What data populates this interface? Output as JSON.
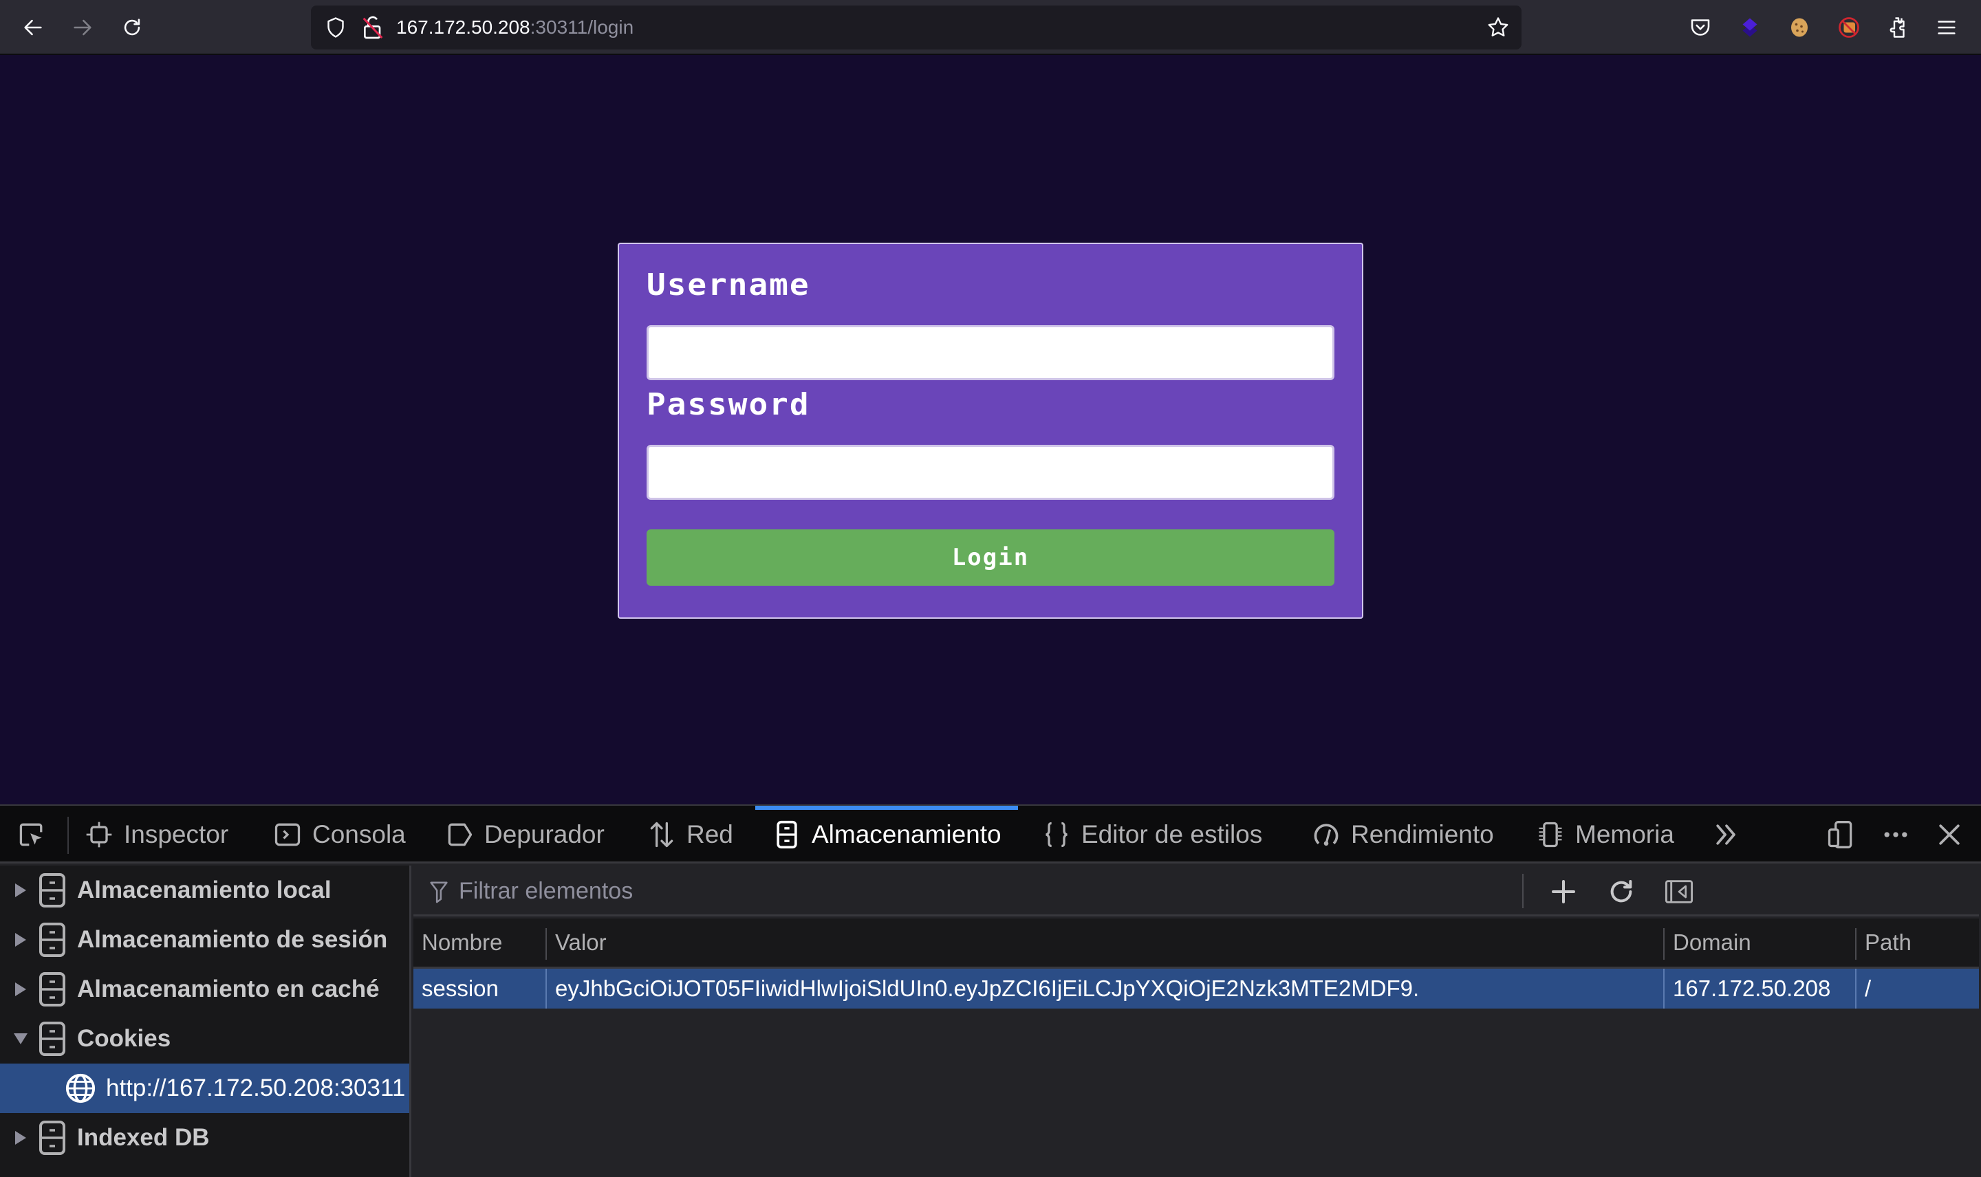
{
  "browser": {
    "url_host": "167.172.50.208",
    "url_rest": ":30311/login",
    "nav": {
      "back_icon": "arrow-left-icon",
      "forward_icon": "arrow-right-icon",
      "reload_icon": "reload-icon"
    },
    "extensions": [
      "pocket-icon",
      "purple-layers-extension-icon",
      "cookie-extension-icon",
      "blocked-extension-icon",
      "puzzle-extensions-icon",
      "hamburger-menu-icon"
    ]
  },
  "page": {
    "username_label": "Username",
    "username_value": "",
    "password_label": "Password",
    "password_value": "",
    "login_button": "Login",
    "colors": {
      "background": "#140b2e",
      "form": "#6a45b9",
      "button": "#66ad5b"
    }
  },
  "devtools": {
    "tabs": [
      {
        "label": "Inspector",
        "icon": "inspector-icon"
      },
      {
        "label": "Consola",
        "icon": "console-icon"
      },
      {
        "label": "Depurador",
        "icon": "debugger-icon"
      },
      {
        "label": "Red",
        "icon": "network-icon"
      },
      {
        "label": "Almacenamiento",
        "icon": "storage-icon",
        "active": true
      },
      {
        "label": "Editor de estilos",
        "icon": "style-editor-icon"
      },
      {
        "label": "Rendimiento",
        "icon": "performance-icon"
      },
      {
        "label": "Memoria",
        "icon": "memory-icon"
      }
    ],
    "accent_color": "#3c8cf1",
    "sidebar": [
      {
        "label": "Almacenamiento local",
        "expanded": false
      },
      {
        "label": "Almacenamiento de sesión",
        "expanded": false
      },
      {
        "label": "Almacenamiento en caché",
        "expanded": false
      },
      {
        "label": "Cookies",
        "expanded": true
      },
      {
        "label": "http://167.172.50.208:30311",
        "selected": true,
        "child": true
      },
      {
        "label": "Indexed DB",
        "expanded": false
      }
    ],
    "filter_placeholder": "Filtrar elementos",
    "table": {
      "columns": [
        "Nombre",
        "Valor",
        "Domain",
        "Path"
      ],
      "rows": [
        {
          "name": "session",
          "value": "eyJhbGciOiJOT05FIiwidHlwIjoiSldUIn0.eyJpZCI6IjEiLCJpYXQiOjE2Nzk3MTE2MDF9.",
          "domain": "167.172.50.208",
          "path": "/"
        }
      ]
    }
  }
}
